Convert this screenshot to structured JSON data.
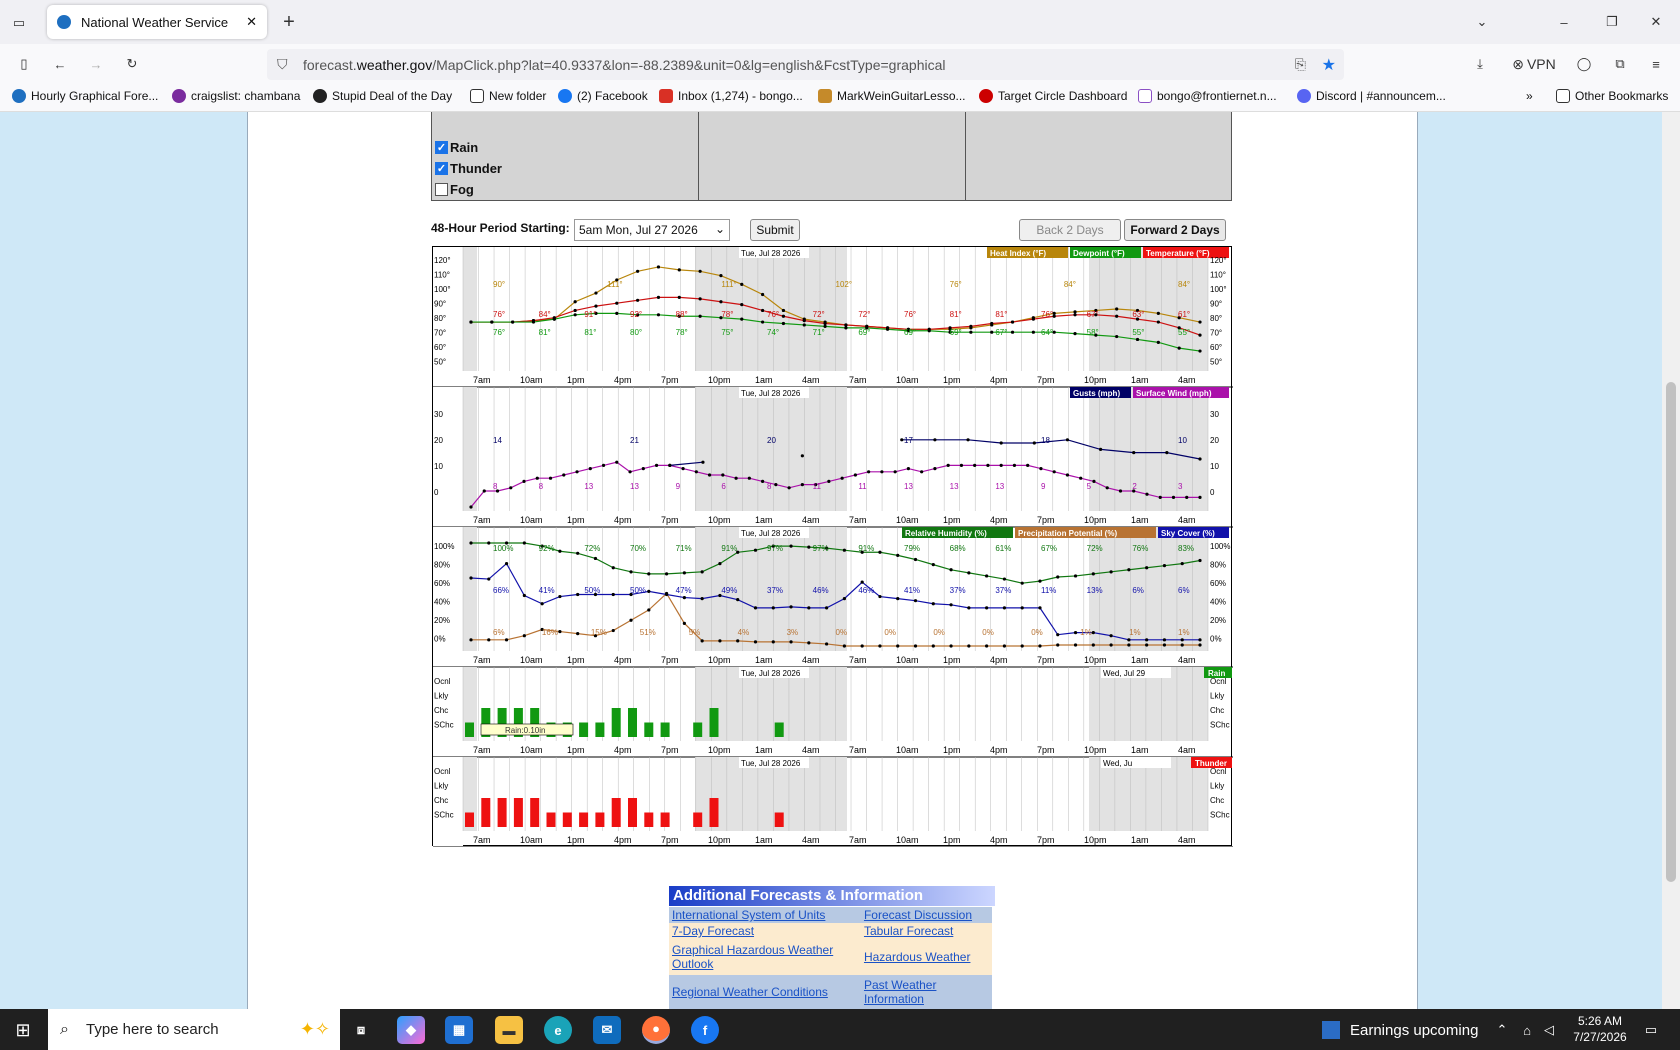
{
  "browser": {
    "tab_title": "National Weather Service",
    "url_prefix": "forecast.",
    "url_domain": "weather.gov",
    "url_path": "/MapClick.php?lat=40.9337&lon=-88.2389&unit=0&lg=english&FcstType=graphical",
    "vpn_label": "VPN",
    "bookmarks": [
      "Hourly Graphical Fore...",
      "craigslist: chambana",
      "Stupid Deal of the Day",
      "New folder",
      "(2) Facebook",
      "Inbox (1,274) - bongo...",
      "MarkWeinGuitarLesso...",
      "Target Circle Dashboard",
      "bongo@frontiernet.n...",
      "Discord | #announcem..."
    ],
    "other_bookmarks": "Other Bookmarks"
  },
  "filters": {
    "rain": "Rain",
    "thunder": "Thunder",
    "fog": "Fog"
  },
  "controls": {
    "period_label": "48-Hour Period Starting:",
    "period_value": "5am Mon, Jul 27 2026",
    "submit": "Submit",
    "back": "Back 2 Days",
    "forward": "Forward 2 Days"
  },
  "chart_data": [
    {
      "type": "line",
      "title": "Temperature panel",
      "date_label": "Tue, Jul 28 2026",
      "legend": [
        "Heat Index (°F)",
        "Dewpoint (°F)",
        "Temperature (°F)"
      ],
      "ylim": [
        45,
        125
      ],
      "yticks": [
        "120°",
        "110°",
        "100°",
        "90°",
        "80°",
        "70°",
        "60°",
        "50°"
      ],
      "xticks": [
        "7am",
        "10am",
        "1pm",
        "4pm",
        "7pm",
        "10pm",
        "1am",
        "4am",
        "7am",
        "10am",
        "1pm",
        "4pm",
        "7pm",
        "10pm",
        "1am",
        "4am"
      ],
      "series": [
        {
          "name": "Heat Index (°F)",
          "values": [
            76,
            76,
            76,
            77,
            78,
            90,
            96,
            105,
            111,
            114,
            112,
            111,
            108,
            102,
            95,
            84,
            78,
            76,
            74,
            73,
            72,
            71,
            71,
            71,
            72,
            74,
            76,
            79,
            82,
            83,
            84,
            85,
            84,
            82,
            79,
            76
          ]
        },
        {
          "name": "Temperature (°F)",
          "values": [
            76,
            76,
            76,
            77,
            79,
            84,
            87,
            89,
            91,
            93,
            93,
            92,
            90,
            88,
            84,
            80,
            77,
            75,
            74,
            73,
            72,
            71,
            71,
            72,
            73,
            75,
            76,
            78,
            80,
            81,
            81,
            80,
            78,
            76,
            72,
            67
          ]
        },
        {
          "name": "Dewpoint (°F)",
          "values": [
            76,
            76,
            76,
            76,
            78,
            81,
            82,
            82,
            81,
            81,
            80,
            80,
            79,
            78,
            76,
            75,
            74,
            73,
            72,
            72,
            71,
            70,
            70,
            69,
            69,
            69,
            69,
            69,
            69,
            68,
            67,
            66,
            64,
            62,
            58,
            56
          ]
        }
      ],
      "labels": {
        "heat": [
          "90°",
          "111°",
          "111°",
          "102°",
          "76°",
          "84°",
          "84°"
        ],
        "temp": [
          "76°",
          "84°",
          "91°",
          "92°",
          "88°",
          "78°",
          "76°",
          "72°",
          "72°",
          "76°",
          "81°",
          "81°",
          "76°",
          "67°",
          "63°",
          "61°"
        ],
        "dew": [
          "76°",
          "81°",
          "81°",
          "80°",
          "78°",
          "75°",
          "74°",
          "71°",
          "69°",
          "69°",
          "69°",
          "67°",
          "64°",
          "58°",
          "55°",
          "55°"
        ]
      }
    },
    {
      "type": "line",
      "title": "Wind panel",
      "date_label": "Tue, Jul 28 2026",
      "legend": [
        "Gusts (mph)",
        "Surface Wind (mph)"
      ],
      "ylim": [
        0,
        35
      ],
      "yticks": [
        "30",
        "20",
        "10",
        "0"
      ],
      "series": [
        {
          "name": "Surface Wind (mph)",
          "values": [
            0,
            5,
            5,
            6,
            8,
            9,
            9,
            10,
            11,
            12,
            13,
            14,
            11,
            12,
            13,
            13,
            12,
            11,
            10,
            10,
            9,
            9,
            8,
            7,
            6,
            7,
            7,
            8,
            9,
            10,
            11,
            11,
            11,
            12,
            11,
            12,
            13,
            13,
            13,
            13,
            13,
            13,
            13,
            12,
            11,
            10,
            9,
            8,
            6,
            5,
            5,
            4,
            3,
            3,
            3,
            3
          ]
        },
        {
          "name": "Gusts (mph)",
          "values": [
            null,
            null,
            null,
            null,
            null,
            null,
            13,
            14,
            null,
            null,
            16,
            null,
            null,
            21,
            21,
            21,
            20,
            20,
            21,
            18,
            17,
            17,
            15
          ]
        },
        {
          "name": "labels",
          "values": [
            "8",
            "8",
            "13",
            "13",
            "9",
            "6",
            "8",
            "11",
            "11",
            "13",
            "13",
            "13",
            "9",
            "5",
            "2",
            "3"
          ]
        }
      ],
      "gust_labels": [
        "14",
        "21",
        "20",
        "17",
        "18",
        "10"
      ]
    },
    {
      "type": "line",
      "title": "Humidity panel",
      "date_label": "Tue, Jul 28 2026",
      "legend": [
        "Relative Humidity (%)",
        "Precipitation Potential (%)",
        "Sky Cover (%)"
      ],
      "ylim": [
        0,
        100
      ],
      "yticks": [
        "100%",
        "80%",
        "60%",
        "40%",
        "20%",
        "0%"
      ],
      "series": [
        {
          "name": "Relative Humidity (%)",
          "values": [
            100,
            100,
            100,
            100,
            97,
            92,
            90,
            85,
            76,
            72,
            70,
            70,
            71,
            72,
            80,
            91,
            93,
            97,
            97,
            96,
            95,
            93,
            91,
            91,
            88,
            84,
            79,
            74,
            71,
            68,
            65,
            61,
            63,
            67,
            68,
            70,
            72,
            74,
            76,
            78,
            80,
            83
          ]
        },
        {
          "name": "Precipitation Potential (%)",
          "values": [
            6,
            6,
            6,
            10,
            16,
            14,
            12,
            10,
            15,
            25,
            35,
            51,
            22,
            5,
            5,
            5,
            4,
            4,
            4,
            3,
            2,
            0,
            0,
            0,
            0,
            0,
            0,
            0,
            0,
            0,
            0,
            0,
            0,
            1,
            1,
            1,
            1,
            1,
            1,
            1,
            1,
            1
          ]
        },
        {
          "name": "Sky Cover (%)",
          "values": [
            66,
            65,
            80,
            49,
            41,
            48,
            50,
            50,
            50,
            50,
            53,
            50,
            47,
            46,
            49,
            45,
            37,
            37,
            38,
            37,
            37,
            46,
            62,
            48,
            46,
            44,
            41,
            40,
            37,
            37,
            37,
            37,
            37,
            11,
            13,
            13,
            10,
            6,
            6,
            6,
            6,
            6
          ]
        }
      ],
      "labels": {
        "rh": [
          "100%",
          "92%",
          "72%",
          "70%",
          "71%",
          "91%",
          "97%",
          "97%",
          "91%",
          "79%",
          "68%",
          "61%",
          "67%",
          "72%",
          "76%",
          "83%"
        ],
        "pop": [
          "6%",
          "16%",
          "15%",
          "51%",
          "5%",
          "4%",
          "3%",
          "0%",
          "0%",
          "0%",
          "0%",
          "0%",
          "1%",
          "1%",
          "1%"
        ],
        "sky": [
          "66%",
          "41%",
          "50%",
          "50%",
          "47%",
          "49%",
          "37%",
          "46%",
          "46%",
          "41%",
          "37%",
          "37%",
          "11%",
          "13%",
          "6%",
          "6%"
        ]
      }
    },
    {
      "type": "bar",
      "title": "Rain",
      "date_labels": [
        "Tue, Jul 28 2026",
        "Wed, Jul 29"
      ],
      "yticks": [
        "Ocnl",
        "Lkly",
        "Chc",
        "SChc"
      ],
      "tooltip": "Rain:0.10in",
      "values": [
        1,
        2,
        2,
        2,
        2,
        1,
        1,
        1,
        1,
        2,
        2,
        1,
        1,
        0,
        1,
        2,
        0,
        0,
        0,
        1
      ]
    },
    {
      "type": "bar",
      "title": "Thunder",
      "date_labels": [
        "Tue, Jul 28 2026",
        "Wed, Ju"
      ],
      "yticks": [
        "Ocnl",
        "Lkly",
        "Chc",
        "SChc"
      ],
      "values": [
        1,
        2,
        2,
        2,
        2,
        1,
        1,
        1,
        1,
        2,
        2,
        1,
        1,
        0,
        1,
        2,
        0,
        0,
        0,
        1
      ]
    }
  ],
  "additional": {
    "title": "Additional Forecasts & Information",
    "links": [
      "International System of Units",
      "Forecast Discussion",
      "7-Day Forecast",
      "Tabular Forecast",
      "Graphical Hazardous Weather Outlook",
      "Hazardous Weather",
      "Regional Weather Conditions",
      "Past Weather Information"
    ]
  },
  "taskbar": {
    "search_placeholder": "Type here to search",
    "news": "Earnings upcoming",
    "time": "5:26 AM",
    "date": "7/27/2026"
  }
}
